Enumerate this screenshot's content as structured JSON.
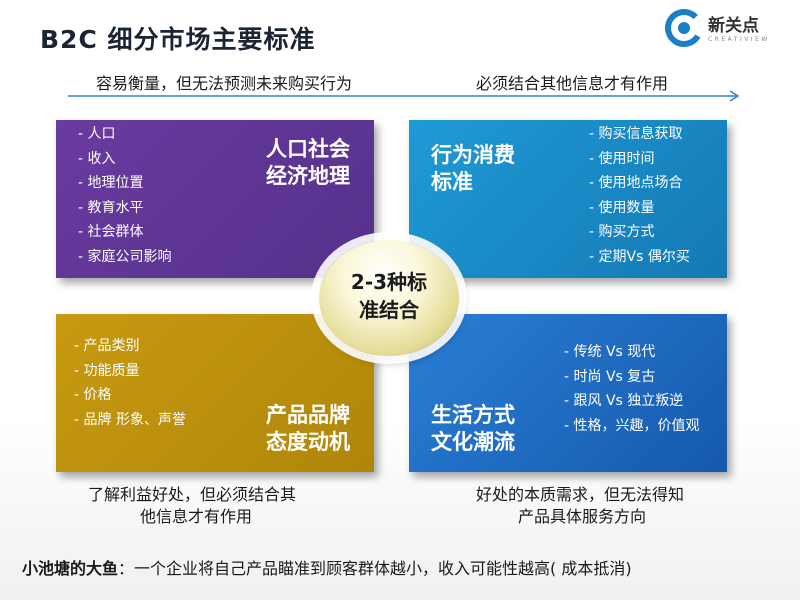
{
  "title": "B2C 细分市场主要标准",
  "logo": {
    "name": "新关点",
    "sub": "CREATIVIEW"
  },
  "top_left_caption": "容易衡量，但无法预测未来购买行为",
  "top_right_caption": "必须结合其他信息才有作用",
  "quadrants": {
    "demographic": {
      "heading_line1": "人口社会",
      "heading_line2": "经济地理",
      "items": [
        "- 人口",
        "- 收入",
        "- 地理位置",
        "- 教育水平",
        "- 社会群体",
        "- 家庭公司影响"
      ]
    },
    "behavior": {
      "heading_line1": "行为消费",
      "heading_line2": "标准",
      "items": [
        "- 购买信息获取",
        "- 使用时间",
        "- 使用地点场合",
        "- 使用数量",
        "- 购买方式",
        "- 定期Vs 偶尔买"
      ]
    },
    "product": {
      "heading_line1": "产品品牌",
      "heading_line2": "态度动机",
      "items": [
        "- 产品类别",
        "- 功能质量",
        "- 价格",
        "- 品牌 形象、声誉"
      ]
    },
    "lifestyle": {
      "heading_line1": "生活方式",
      "heading_line2": "文化潮流",
      "items": [
        "- 传统 Vs  现代",
        "-  时尚 Vs 复古",
        "-  跟风 Vs 独立叛逆",
        "-  性格，兴趣，价值观"
      ]
    }
  },
  "center": {
    "line1": "2-3种标",
    "line2": "准结合"
  },
  "bottom_left_caption_line1": "了解利益好处，但必须结合其",
  "bottom_left_caption_line2": "他信息才有作用",
  "bottom_right_caption_line1": "好处的本质需求，但无法得知",
  "bottom_right_caption_line2": "产品具体服务方向",
  "footer": {
    "bold": "小池塘的大鱼",
    "text": "：一个企业将自己产品瞄准到顾客群体越小，收入可能性越高( 成本抵消)"
  },
  "colors": {
    "purple": "#6a3ba0",
    "blue": "#1f9ad6",
    "gold": "#c79a10",
    "navy": "#2a7fd6",
    "arrow": "#3a7bd5"
  }
}
